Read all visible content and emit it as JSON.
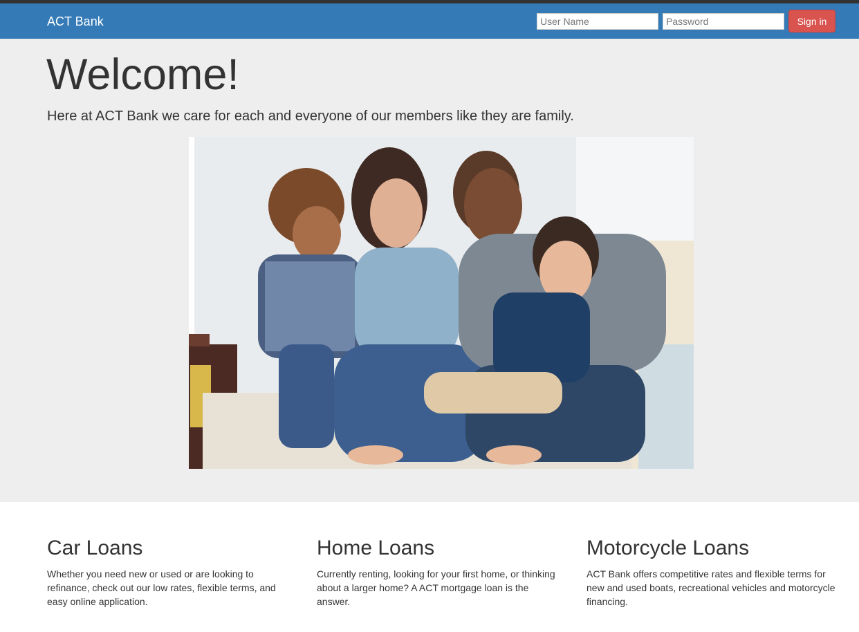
{
  "navbar": {
    "brand": "ACT Bank",
    "username_placeholder": "User Name",
    "password_placeholder": "Password",
    "signin_label": "Sign in",
    "bg_color": "#337ab7",
    "signin_color": "#d9534f"
  },
  "hero": {
    "title": "Welcome!",
    "lead": "Here at ACT Bank we care for each and everyone of our members like they are family.",
    "image_alt": "family-photo"
  },
  "features": [
    {
      "title": "Car Loans",
      "text": "Whether you need new or used or are looking to refinance, check out our low rates, flexible terms, and easy online application."
    },
    {
      "title": "Home Loans",
      "text": "Currently renting, looking for your first home, or thinking about a larger home? A ACT mortgage loan is the answer."
    },
    {
      "title": "Motorcycle Loans",
      "text": "ACT Bank offers competitive rates and flexible terms for new and used boats, recreational vehicles and motorcycle financing."
    }
  ]
}
